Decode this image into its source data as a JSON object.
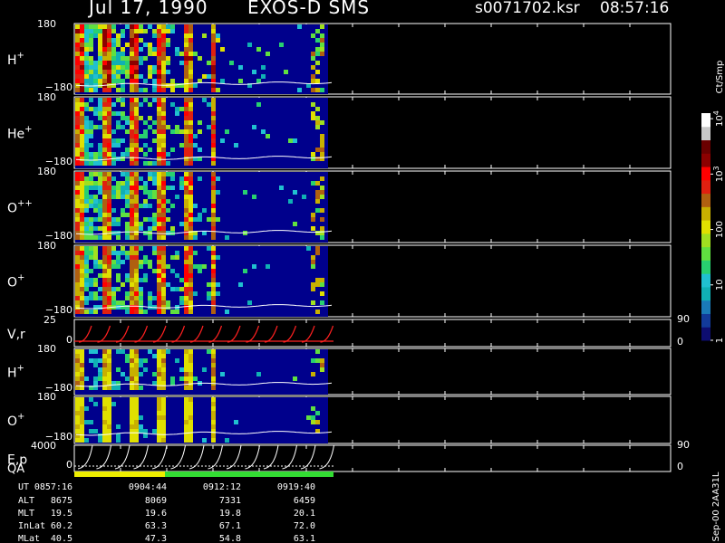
{
  "header": {
    "date": "Jul 17, 1990",
    "instrument": "EXOS-D SMS",
    "file": "s0071702.ksr",
    "time": "08:57:16"
  },
  "colors": {
    "background": "#000000",
    "data_background": "#00008c",
    "qa_good": "#33dd33",
    "qa_warn": "#eeee00",
    "vr_trace": "#ff2020"
  },
  "chart_data": {
    "type": "heatmap",
    "panels": [
      {
        "label": "H",
        "sup": "+",
        "ytop": "180",
        "ybot": "−180",
        "ylim": [
          -180,
          180
        ],
        "kind": "spectrogram",
        "activity": "strong"
      },
      {
        "label": "He",
        "sup": "+",
        "ytop": "180",
        "ybot": "−180",
        "ylim": [
          -180,
          180
        ],
        "kind": "spectrogram",
        "activity": "medium"
      },
      {
        "label": "O",
        "sup": "++",
        "ytop": "180",
        "ybot": "−180",
        "ylim": [
          -180,
          180
        ],
        "kind": "spectrogram",
        "activity": "medium"
      },
      {
        "label": "O",
        "sup": "+",
        "ytop": "180",
        "ybot": "−180",
        "ylim": [
          -180,
          180
        ],
        "kind": "spectrogram",
        "activity": "medium"
      },
      {
        "label": "V,r",
        "sup": "",
        "ytop": "25",
        "ybot": "0",
        "ylim": [
          0,
          25
        ],
        "right_top": "90",
        "right_bot": "0",
        "kind": "line"
      },
      {
        "label": "H",
        "sup": "+",
        "ytop": "180",
        "ybot": "−180",
        "ylim": [
          -180,
          180
        ],
        "kind": "spectrogram",
        "activity": "weak"
      },
      {
        "label": "O",
        "sup": "+",
        "ytop": "180",
        "ybot": "−180",
        "ylim": [
          -180,
          180
        ],
        "kind": "spectrogram",
        "activity": "faint"
      },
      {
        "label": "E,p",
        "sub": "QA",
        "sup": "",
        "ytop": "4000",
        "ybot": "0",
        "ylim": [
          0,
          4000
        ],
        "right_top": "90",
        "right_bot": "0",
        "kind": "sweep"
      }
    ],
    "colorbar": {
      "label": "Ct/Smp",
      "scale": "log",
      "ticks": [
        {
          "value": 1,
          "label": "1"
        },
        {
          "value": 10,
          "label": "10"
        },
        {
          "value": 100,
          "label": "100"
        },
        {
          "value": 1000,
          "label": "10",
          "exp": "3"
        },
        {
          "value": 10000,
          "label": "10",
          "exp": "4"
        }
      ],
      "colors": [
        "#0d0d70",
        "#123a9a",
        "#1a7ab8",
        "#10b0b4",
        "#20c0d0",
        "#28d070",
        "#60e040",
        "#a0e020",
        "#e0e000",
        "#c8b000",
        "#b06010",
        "#e02010",
        "#ff0000",
        "#8c0000",
        "#6a0000",
        "#c8c8c8",
        "#ffffff"
      ]
    },
    "time_table": {
      "row_labels": [
        "UT",
        "ALT",
        "MLT",
        "InLat",
        "MLat"
      ],
      "columns": [
        [
          "0857:16",
          "8675",
          "19.5",
          "60.2",
          "40.5"
        ],
        [
          "0904:44",
          "8069",
          "19.6",
          "63.3",
          "47.3"
        ],
        [
          "0912:12",
          "7331",
          "19.8",
          "67.1",
          "54.8"
        ],
        [
          "0919:40",
          "6459",
          "20.1",
          "72.0",
          "63.1"
        ]
      ]
    },
    "footer_note": "Sep-00 2AA31L"
  }
}
